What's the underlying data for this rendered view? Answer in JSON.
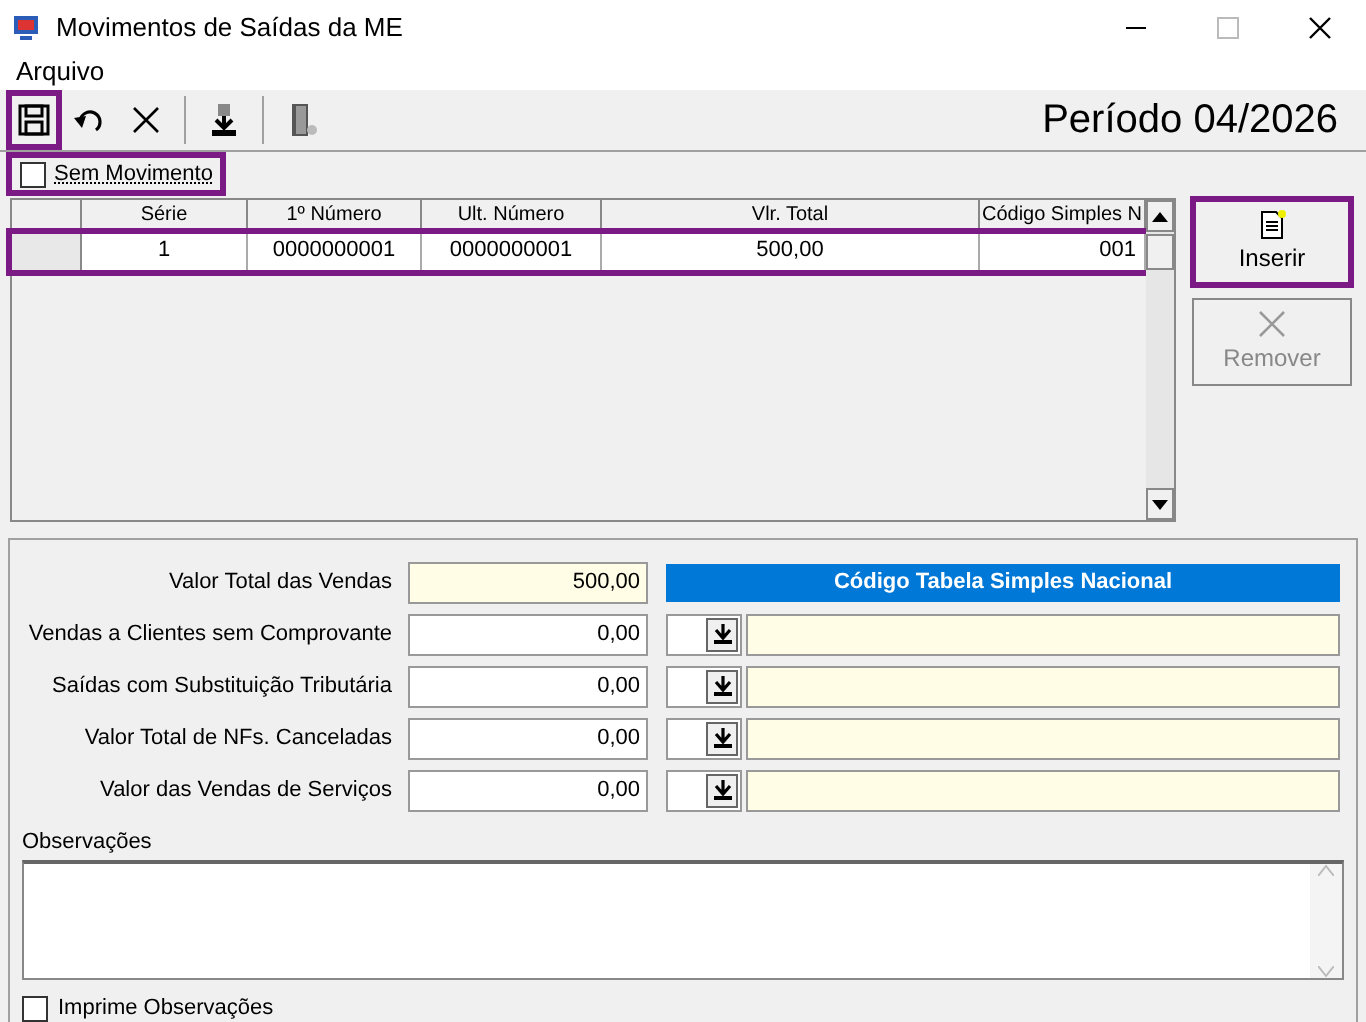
{
  "window": {
    "title": "Movimentos de Saídas da ME"
  },
  "menu": [
    "Arquivo"
  ],
  "toolbar": [
    {
      "kind": "save",
      "highlighted": true
    },
    {
      "kind": "undo",
      "highlighted": false
    },
    {
      "kind": "cancel",
      "highlighted": false
    },
    {
      "kind": "sep"
    },
    {
      "kind": "import",
      "highlighted": false
    },
    {
      "kind": "sep"
    },
    {
      "kind": "exit",
      "highlighted": false
    }
  ],
  "period": "Período 04/2026",
  "no_movement": {
    "label": "Sem Movimento",
    "checked": false,
    "highlighted": true
  },
  "table": {
    "columns": [
      "Série",
      "1º Número",
      "Ult. Número",
      "Vlr. Total",
      "Código Simples N"
    ],
    "rows": [
      {
        "cells": [
          "1",
          "0000000001",
          "0000000001",
          "500,00",
          "001"
        ],
        "highlighted": true
      }
    ]
  },
  "buttons": [
    {
      "label": "Inserir",
      "kind": "insert",
      "disabled": false,
      "highlighted": true
    },
    {
      "label": "Remover",
      "kind": "remove",
      "disabled": true,
      "highlighted": false
    }
  ],
  "totals": [
    {
      "label": "Valor Total das Vendas",
      "value": "500,00",
      "kind": "total"
    },
    {
      "label": "Vendas a Clientes sem Comprovante",
      "value": "0,00",
      "kind": "code"
    },
    {
      "label": "Saídas com Substituição Tributária",
      "value": "0,00",
      "kind": "code"
    },
    {
      "label": "Valor Total de NFs. Canceladas",
      "value": "0,00",
      "kind": "code"
    },
    {
      "label": "Valor das Vendas de Serviços",
      "value": "0,00",
      "kind": "code"
    }
  ],
  "code_table_header": "Código Tabela Simples Nacional",
  "observations": {
    "label": "Observações"
  },
  "print_observations": {
    "label": "Imprime Observações",
    "checked": false
  }
}
